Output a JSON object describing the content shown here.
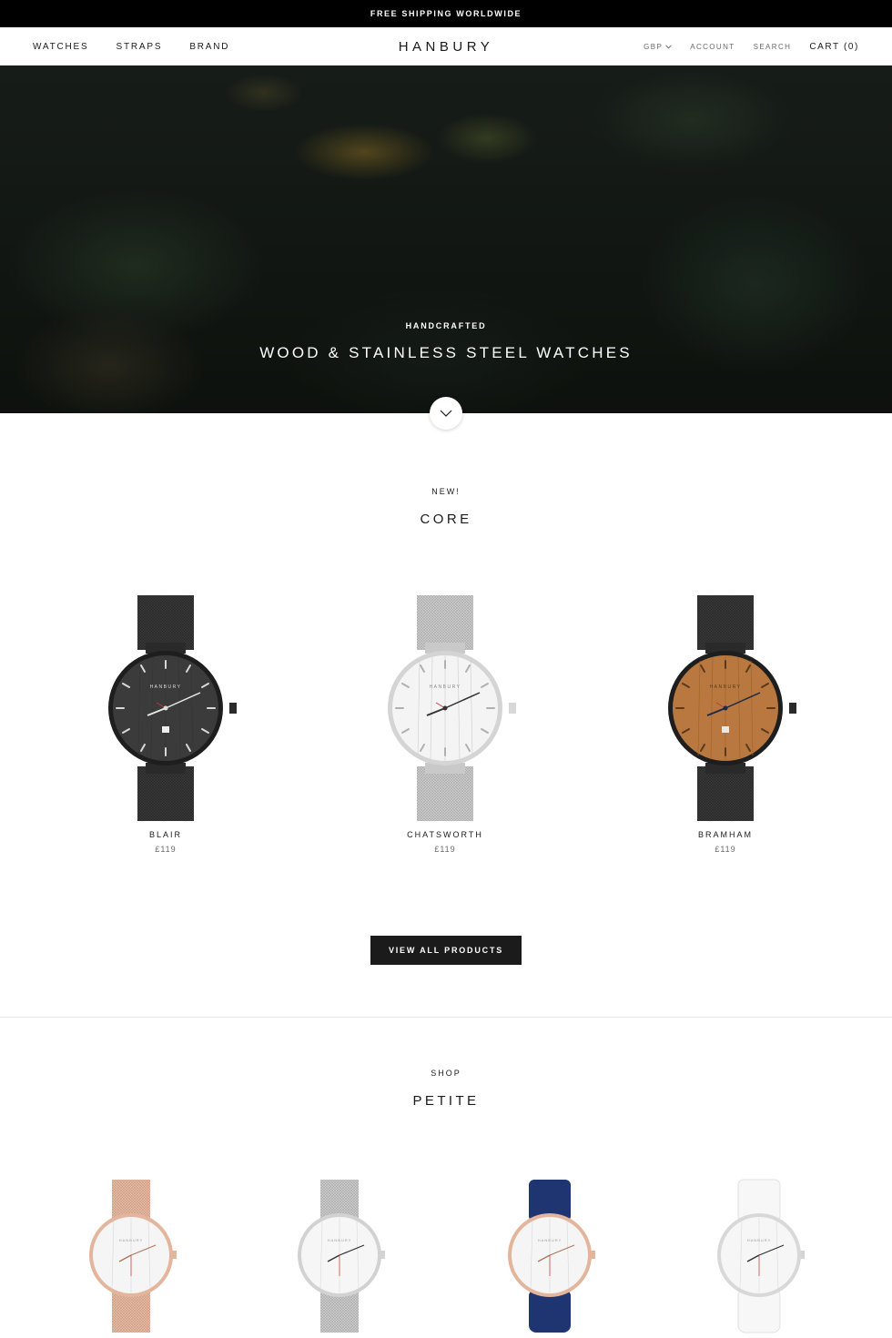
{
  "announcement": "FREE SHIPPING WORLDWIDE",
  "header": {
    "nav": [
      "WATCHES",
      "STRAPS",
      "BRAND"
    ],
    "logo": "HANBURY",
    "currency": "GBP",
    "account": "ACCOUNT",
    "search": "SEARCH",
    "cart": "CART (0)"
  },
  "hero": {
    "kicker": "HANDCRAFTED",
    "title": "WOOD & STAINLESS STEEL WATCHES"
  },
  "core": {
    "kicker": "NEW!",
    "title": "CORE",
    "products": [
      {
        "name": "BLAIR",
        "price": "£119"
      },
      {
        "name": "CHATSWORTH",
        "price": "£119"
      },
      {
        "name": "BRAMHAM",
        "price": "£119"
      }
    ],
    "view_all": "VIEW ALL PRODUCTS"
  },
  "petite": {
    "kicker": "SHOP",
    "title": "PETITE"
  },
  "watch_dial_text": "HANBURY",
  "colors": {
    "black": "#1c1b1b",
    "steel": "#c8c8c8",
    "rose_gold": "#e2b59c",
    "navy": "#1f3572",
    "walnut": "#b8783f"
  },
  "icons": [
    "chevron-down-icon"
  ]
}
